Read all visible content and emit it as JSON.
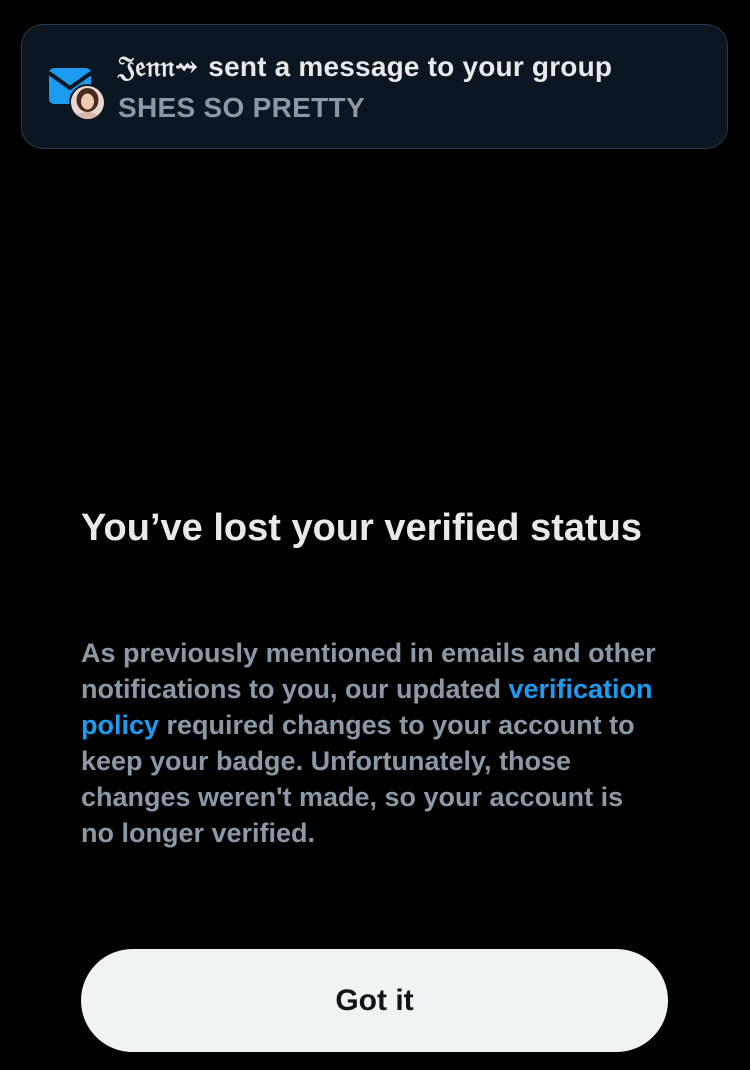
{
  "notification": {
    "icon": "envelope-icon",
    "sender": "𝔍𝔢𝔫𝔫⇝",
    "message": "sent a message to your group",
    "preview": "SHES SO PRETTY",
    "colors": {
      "background": "#0c1621",
      "border": "#2c3a48",
      "envelope": "#1d9bf0"
    }
  },
  "dialog": {
    "title": "You’ve lost your verified status",
    "body_before_link": "As previously mentioned in emails and other notifications to you, our updated ",
    "link_text": "verification policy",
    "body_after_link": " required changes to your account to keep your badge. Unfortunately, those changes weren't made, so your account is no longer verified.",
    "button_label": "Got it",
    "colors": {
      "background": "#000000",
      "title": "#e7e9ea",
      "body": "#8b98a5",
      "link": "#1d9bf0",
      "button_bg": "#eff3f4",
      "button_text": "#0f1419"
    }
  }
}
